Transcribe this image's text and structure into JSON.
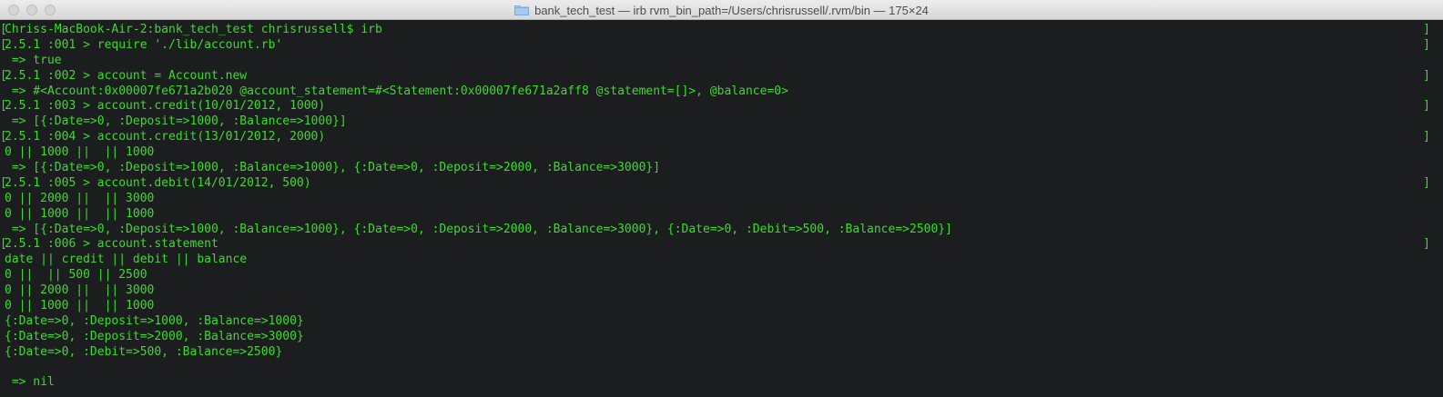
{
  "window": {
    "title": "bank_tech_test — irb rvm_bin_path=/Users/chrisrussell/.rvm/bin — 175×24"
  },
  "colors": {
    "terminal_background": "#1b1d1e",
    "terminal_text": "#3cdc2c",
    "titlebar": "#e0e0e0"
  },
  "terminal": {
    "lines": [
      {
        "text": "Chriss-MacBook-Air-2:bank_tech_test chrisrussell$ irb",
        "marked": true
      },
      {
        "text": "2.5.1 :001 > require './lib/account.rb'",
        "marked": true
      },
      {
        "text": " => true",
        "marked": false
      },
      {
        "text": "2.5.1 :002 > account = Account.new",
        "marked": true
      },
      {
        "text": " => #<Account:0x00007fe671a2b020 @account_statement=#<Statement:0x00007fe671a2aff8 @statement=[]>, @balance=0>",
        "marked": false
      },
      {
        "text": "2.5.1 :003 > account.credit(10/01/2012, 1000)",
        "marked": true
      },
      {
        "text": " => [{:Date=>0, :Deposit=>1000, :Balance=>1000}]",
        "marked": false
      },
      {
        "text": "2.5.1 :004 > account.credit(13/01/2012, 2000)",
        "marked": true
      },
      {
        "text": "0 || 1000 ||  || 1000",
        "marked": false
      },
      {
        "text": " => [{:Date=>0, :Deposit=>1000, :Balance=>1000}, {:Date=>0, :Deposit=>2000, :Balance=>3000}]",
        "marked": false
      },
      {
        "text": "2.5.1 :005 > account.debit(14/01/2012, 500)",
        "marked": true
      },
      {
        "text": "0 || 2000 ||  || 3000",
        "marked": false
      },
      {
        "text": "0 || 1000 ||  || 1000",
        "marked": false
      },
      {
        "text": " => [{:Date=>0, :Deposit=>1000, :Balance=>1000}, {:Date=>0, :Deposit=>2000, :Balance=>3000}, {:Date=>0, :Debit=>500, :Balance=>2500}]",
        "marked": false
      },
      {
        "text": "2.5.1 :006 > account.statement",
        "marked": true
      },
      {
        "text": "date || credit || debit || balance",
        "marked": false
      },
      {
        "text": "0 ||  || 500 || 2500",
        "marked": false
      },
      {
        "text": "0 || 2000 ||  || 3000",
        "marked": false
      },
      {
        "text": "0 || 1000 ||  || 1000",
        "marked": false
      },
      {
        "text": "{:Date=>0, :Deposit=>1000, :Balance=>1000}",
        "marked": false
      },
      {
        "text": "{:Date=>0, :Deposit=>2000, :Balance=>3000}",
        "marked": false
      },
      {
        "text": "{:Date=>0, :Debit=>500, :Balance=>2500}",
        "marked": false
      },
      {
        "text": "",
        "marked": false
      },
      {
        "text": " => nil",
        "marked": false
      }
    ]
  }
}
